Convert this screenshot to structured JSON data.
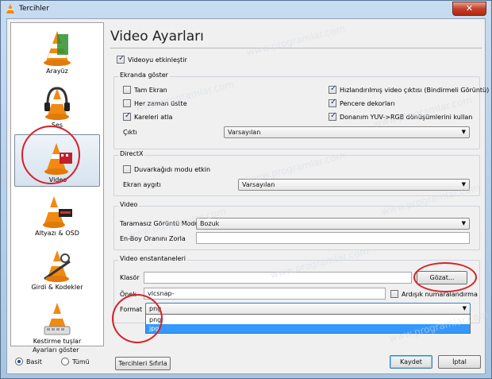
{
  "window": {
    "title": "Tercihler",
    "close_glyph": "✕"
  },
  "sidebar": {
    "items": [
      {
        "label": "Arayüz"
      },
      {
        "label": "Ses"
      },
      {
        "label": "Video"
      },
      {
        "label": "Altyazı & OSD"
      },
      {
        "label": "Girdi & Kodekler"
      },
      {
        "label": "Kestirme tuşlar"
      }
    ],
    "selected": "Video",
    "mode": {
      "title": "Ayarları göster",
      "options": [
        "Basit",
        "Tümü"
      ],
      "selected": "Basit"
    }
  },
  "panel": {
    "title": "Video Ayarları",
    "enable_video": {
      "label": "Videoyu etkinleştir",
      "checked": true
    },
    "display": {
      "title": "Ekranda göster",
      "fullscreen": {
        "label": "Tam Ekran",
        "checked": false
      },
      "always_on_top": {
        "label": "Her zaman üstte",
        "checked": false
      },
      "deinterlace": {
        "label": "Kareleri atla",
        "checked": true
      },
      "accelerated": {
        "label": "Hızlandırılmış video çıktısı (Bindirmeli Görüntü)",
        "checked": true
      },
      "decorations": {
        "label": "Pencere dekorları",
        "checked": true
      },
      "yuv_rgb": {
        "label": "Donanım YUV->RGB dönüşümlerini kullan",
        "checked": true
      },
      "output_label": "Çıktı",
      "output_value": "Varsayılan"
    },
    "directx": {
      "title": "DirectX",
      "wallpaper": {
        "label": "Duvarkağıdı modu etkin",
        "checked": false
      },
      "device_label": "Ekran aygıtı",
      "device_value": "Varsayılan"
    },
    "video": {
      "title": "Video",
      "deint_mode_label": "Taramasız Görüntü Modu",
      "deint_mode_value": "Bozuk",
      "aspect_label": "En-Boy Oranını Zorla",
      "aspect_value": ""
    },
    "snapshots": {
      "title": "Video enstantaneleri",
      "folder_label": "Klasör",
      "folder_value": "",
      "browse_label": "Gözat...",
      "prefix_label": "Önek",
      "prefix_value": "vlcsnap-",
      "sequential": {
        "label": "Ardışık numaralandırma",
        "checked": false
      },
      "format_label": "Format",
      "format_value": "png",
      "format_options": [
        "png",
        "jpg"
      ],
      "format_highlighted": "jpg"
    }
  },
  "footer": {
    "reset_label": "Tercihleri Sıfırla",
    "save_label": "Kaydet",
    "cancel_label": "İptal"
  },
  "watermark": "www.programlar.com",
  "colors": {
    "accent": "#3399ff",
    "annotation": "#d8202a",
    "vlc_orange": "#f08a12"
  }
}
